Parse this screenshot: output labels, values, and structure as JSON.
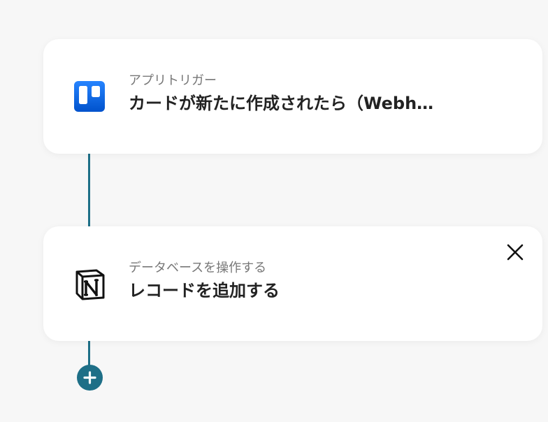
{
  "flow": {
    "trigger": {
      "subtitle": "アプリトリガー",
      "title": "カードが新たに作成されたら（Webh…",
      "icon": "trello-icon"
    },
    "action": {
      "subtitle": "データベースを操作する",
      "title": "レコードを追加する",
      "icon": "notion-icon",
      "close_icon": "close-icon"
    },
    "add_icon": "plus-icon"
  },
  "colors": {
    "background": "#f7f7f7",
    "card": "#ffffff",
    "connector": "#1e6f87",
    "trello_blue": "#0c66e4",
    "subtitle_text": "#777777",
    "title_text": "#222222"
  }
}
